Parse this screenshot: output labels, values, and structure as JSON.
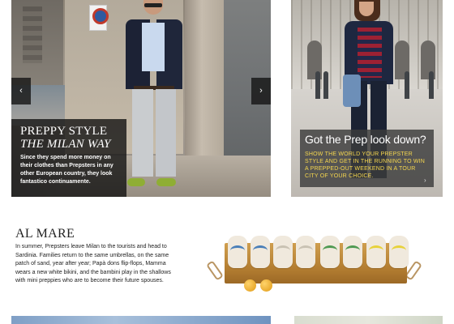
{
  "hero_left": {
    "title_line1": "PREPPY STYLE",
    "title_line2": "THE MILAN WAY",
    "body": "Since they spend more money on their clothes than Prepsters in any other European country, they look fantastico continuamente.",
    "prev_arrow": "‹",
    "next_arrow": "›"
  },
  "hero_right": {
    "title": "Got the Prep look down?",
    "body": "SHOW THE WORLD YOUR PREPSTER STYLE AND GET IN THE RUNNING TO WIN A PREPPED-OUT WEEKEND IN A TOUR CITY OF YOUR CHOICE.",
    "next_arrow": "›"
  },
  "article": {
    "title": "AL MARE",
    "body": "In summer, Prepsters leave Milan to the tourists and head to Sardinia. Families return to the same umbrellas, on the same patch of sand, year after year; Papà dons flip-flops, Mamma wears a new white bikini, and the bambini play in the shallows with mini preppies who are to become their future spouses."
  },
  "colors": {
    "caption_left_bg": "#0f0f0f",
    "caption_right_text": "#f5d64e",
    "flipflop_straps": [
      "#4a7fb8",
      "#4a7fb8",
      "#c9c2b3",
      "#c9c2b3",
      "#4f9a52",
      "#4f9a52",
      "#e7d23a",
      "#e7d23a"
    ]
  }
}
